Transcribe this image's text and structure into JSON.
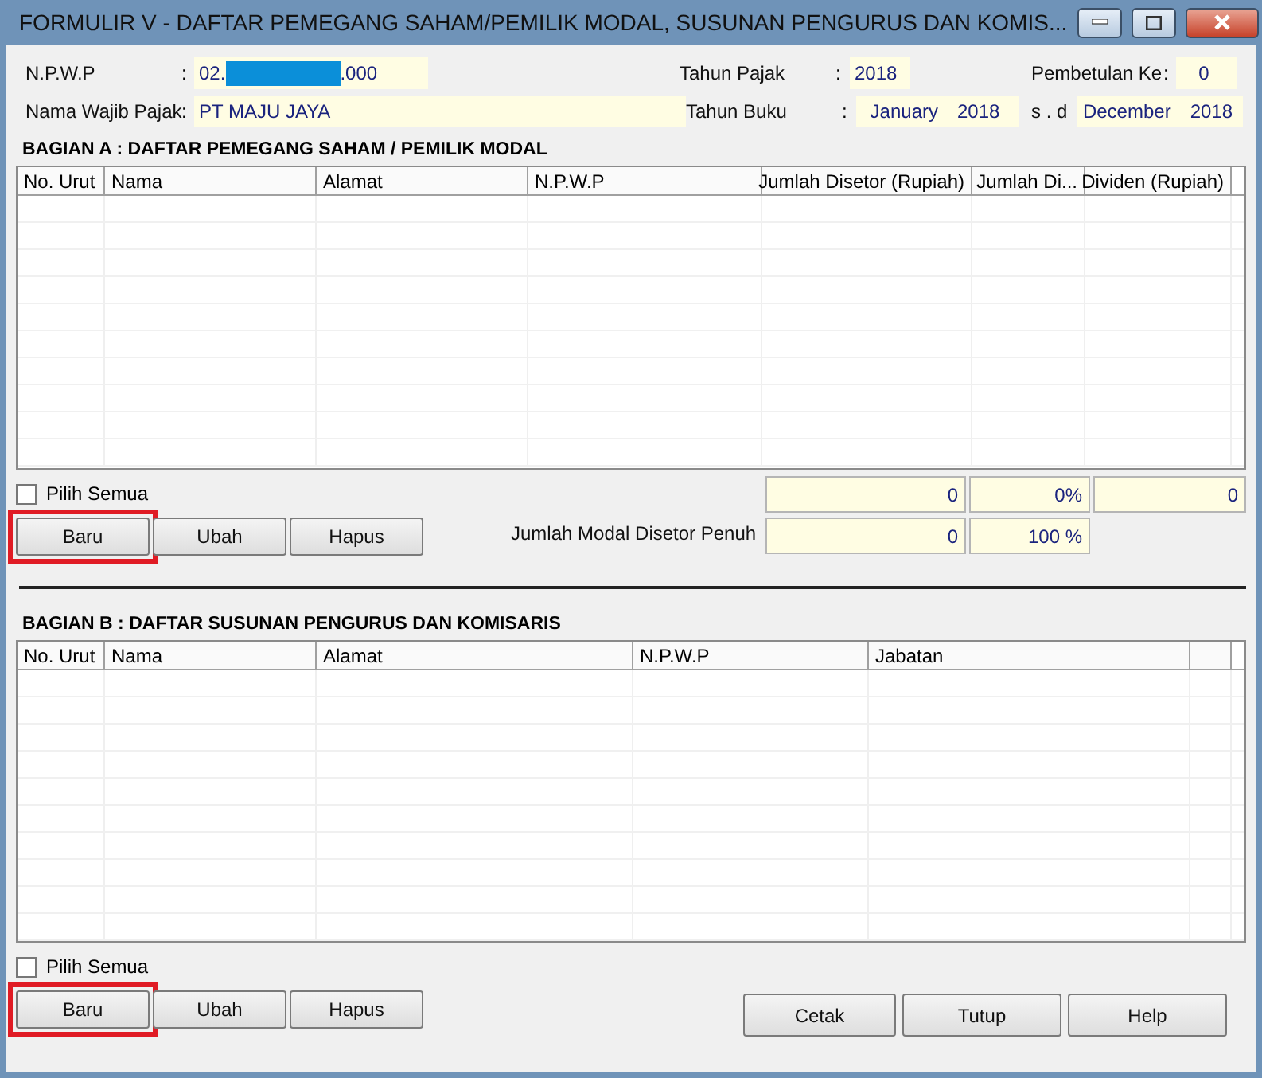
{
  "window": {
    "title": "FORMULIR V - DAFTAR PEMEGANG SAHAM/PEMILIK MODAL, SUSUNAN PENGURUS DAN KOMIS..."
  },
  "header": {
    "npwp": {
      "label": "N.P.W.P",
      "colon": ":",
      "prefix": "02.",
      "redacted": true,
      "suffix": ".000"
    },
    "tahun_pajak": {
      "label": "Tahun Pajak",
      "colon": ":",
      "value": "2018"
    },
    "pembetulan": {
      "label": "Pembetulan Ke",
      "colon": ":",
      "value": "0"
    },
    "nama": {
      "label": "Nama Wajib Pajak",
      "colon": ":",
      "value": "PT MAJU JAYA"
    },
    "tahun_buku": {
      "label": "Tahun Buku",
      "colon": ":",
      "start_month": "January",
      "start_year": "2018",
      "separator": "s . d",
      "end_month": "December",
      "end_year": "2018"
    }
  },
  "section_a": {
    "title": "BAGIAN A : DAFTAR PEMEGANG SAHAM / PEMILIK MODAL",
    "columns": [
      "No. Urut",
      "Nama",
      "Alamat",
      "N.P.W.P",
      "Jumlah Disetor (Rupiah)",
      "Jumlah Di...",
      "Dividen (Rupiah)"
    ],
    "select_all": {
      "label": "Pilih Semua",
      "checked": false
    },
    "buttons": [
      {
        "label": "Baru",
        "highlighted": true
      },
      {
        "label": "Ubah",
        "highlighted": false
      },
      {
        "label": "Hapus",
        "highlighted": false
      }
    ],
    "totals_label": "Jumlah Modal Disetor Penuh",
    "totals_row_1": [
      "0",
      "0%",
      "0"
    ],
    "totals_row_2": [
      "0",
      "100 %"
    ]
  },
  "section_b": {
    "title": "BAGIAN B : DAFTAR SUSUNAN PENGURUS DAN KOMISARIS",
    "columns": [
      "No. Urut",
      "Nama",
      "Alamat",
      "N.P.W.P",
      "Jabatan"
    ],
    "select_all": {
      "label": "Pilih Semua",
      "checked": false
    },
    "buttons": [
      {
        "label": "Baru",
        "highlighted": true
      },
      {
        "label": "Ubah",
        "highlighted": false
      },
      {
        "label": "Hapus",
        "highlighted": false
      }
    ]
  },
  "footer_buttons": [
    {
      "label": "Cetak"
    },
    {
      "label": "Tutup"
    },
    {
      "label": "Help"
    }
  ]
}
